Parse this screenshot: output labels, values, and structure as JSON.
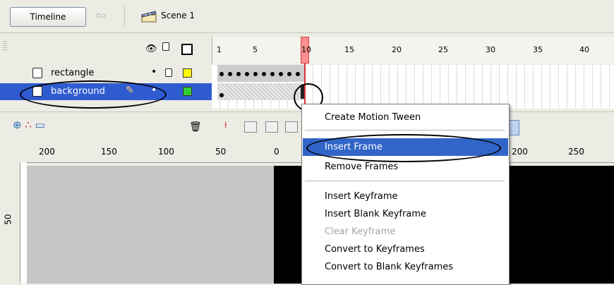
{
  "top_bar": {
    "timeline_button": "Timeline",
    "scene_label": "Scene 1",
    "back_icon": "back-arrow-icon",
    "scene_icon": "clapperboard-icon"
  },
  "frame_ruler": {
    "numbers": [
      "1",
      "5",
      "10",
      "15",
      "20",
      "25",
      "30",
      "35",
      "40"
    ],
    "current_frame": "10"
  },
  "layers": [
    {
      "name": "rectangle",
      "selected": false,
      "color": "#ffff00"
    },
    {
      "name": "background",
      "selected": true,
      "color": "#33cc33"
    }
  ],
  "stage_ruler": {
    "h_labels": [
      "200",
      "150",
      "100",
      "50",
      "0",
      "200",
      "250"
    ],
    "v_labels": [
      "50"
    ]
  },
  "context_menu": {
    "items": [
      {
        "label": "Create Motion Tween",
        "state": "normal"
      },
      {
        "label": "Insert Frame",
        "state": "highlighted"
      },
      {
        "label": "Remove Frames",
        "state": "normal"
      },
      {
        "label": "Insert Keyframe",
        "state": "normal"
      },
      {
        "label": "Insert Blank Keyframe",
        "state": "normal"
      },
      {
        "label": "Clear Keyframe",
        "state": "disabled"
      },
      {
        "label": "Convert to Keyframes",
        "state": "normal"
      },
      {
        "label": "Convert to Blank Keyframes",
        "state": "normal"
      }
    ]
  },
  "colors": {
    "selection": "#3265c8",
    "playhead": "#ff8f8f",
    "stage_background": "#000000"
  }
}
